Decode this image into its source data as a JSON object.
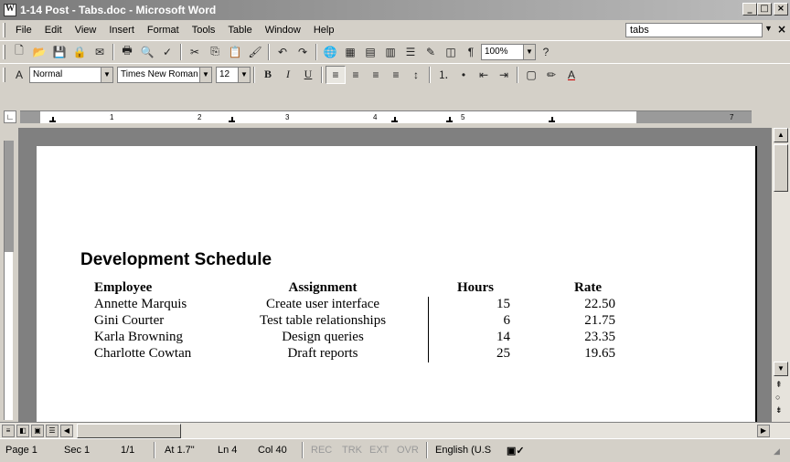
{
  "window": {
    "title": "1-14 Post - Tabs.doc - Microsoft Word",
    "minimize": "_",
    "maximize": "□",
    "close": "×"
  },
  "menubar": {
    "items": [
      "File",
      "Edit",
      "View",
      "Insert",
      "Format",
      "Tools",
      "Table",
      "Window",
      "Help"
    ],
    "help_query": "tabs",
    "doc_close": "×"
  },
  "standard_toolbar": {
    "zoom": "100%"
  },
  "formatting_toolbar": {
    "style": "Normal",
    "font": "Times New Roman",
    "size": "12"
  },
  "ruler": {
    "numbers": [
      "1",
      "2",
      "3",
      "4",
      "5",
      "7"
    ]
  },
  "document": {
    "heading": "Development Schedule",
    "table": {
      "headers": [
        "Employee",
        "Assignment",
        "Hours",
        "Rate"
      ],
      "rows": [
        [
          "Annette Marquis",
          "Create user interface",
          "15",
          "22.50"
        ],
        [
          "Gini Courter",
          "Test table relationships",
          "6",
          "21.75"
        ],
        [
          "Karla Browning",
          "Design queries",
          "14",
          "23.35"
        ],
        [
          "Charlotte Cowtan",
          "Draft reports",
          "25",
          "19.65"
        ]
      ]
    }
  },
  "statusbar": {
    "page": "Page 1",
    "section": "Sec 1",
    "pages": "1/1",
    "at": "At 1.7\"",
    "line": "Ln 4",
    "col": "Col 40",
    "rec": "REC",
    "trk": "TRK",
    "ext": "EXT",
    "ovr": "OVR",
    "language": "English (U.S"
  },
  "colors": {
    "titlebar_start": "#7a7a7a",
    "titlebar_end": "#bdbdbd",
    "chrome": "#d4d0c8",
    "workspace": "#808080"
  }
}
